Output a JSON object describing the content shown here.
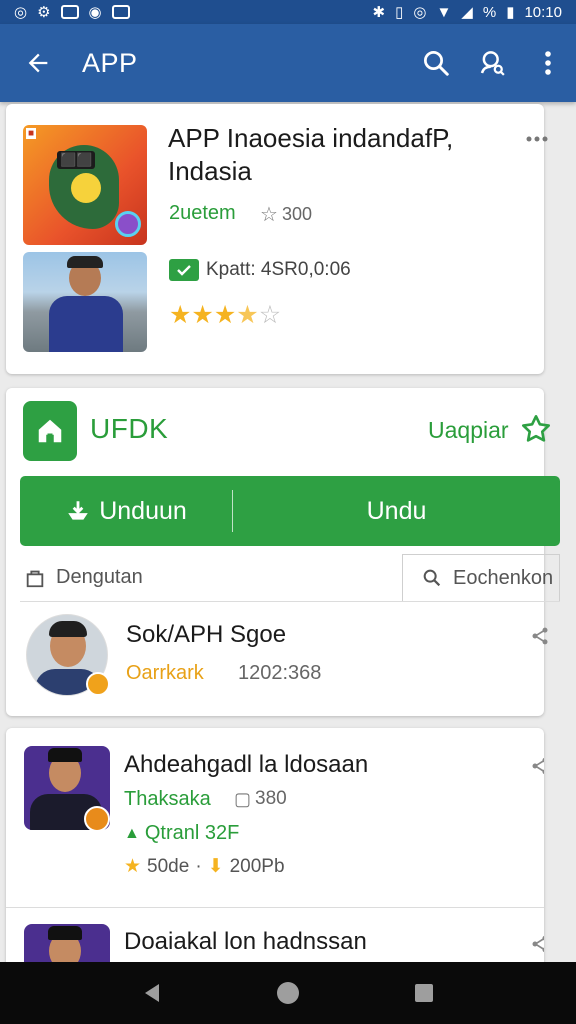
{
  "status_bar": {
    "time": "10:10",
    "battery": "%"
  },
  "app_bar": {
    "title": "APP"
  },
  "app_card": {
    "title": "APP Inaoesia indandafP, Indasia",
    "developer": "2uetem",
    "meta": "300",
    "info": "Kpatt: 4SR0,0:06",
    "rating": 3.5,
    "colors": {
      "accent": "#2ea043",
      "star": "#f5b320"
    }
  },
  "install_card": {
    "app_name": "UFDK",
    "save_label": "Uaqpiar",
    "download_label": "Unduun",
    "second_label": "Undu",
    "follow_label": "Dengutan",
    "search_label": "Eochenkon",
    "author_name": "Sok/APH Sgoe",
    "author_role": "Oarrkark",
    "author_meta": "1202:368"
  },
  "list": {
    "items": [
      {
        "title": "Ahdeahgadl la ldosaan",
        "developer": "Thaksaka",
        "meta": "380",
        "price": "Qtranl 32F",
        "rating_text": "50de",
        "downloads": "200Pb"
      },
      {
        "title": "Doaiakal lon hadnssan"
      }
    ]
  }
}
